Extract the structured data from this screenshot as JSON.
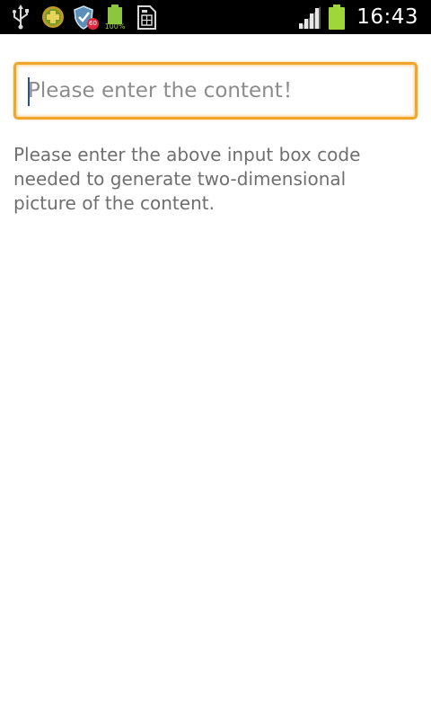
{
  "status_bar": {
    "notification_icons": [
      "usb-icon",
      "game-controller-icon",
      "shield-icon",
      "battery-full-icon",
      "sim-card-icon"
    ],
    "shield_badge": "60",
    "battery_notification_label": "100%",
    "signal_icon": "signal-bars-icon",
    "battery_icon": "battery-icon",
    "time": "16:43"
  },
  "form": {
    "content_input": {
      "value": "",
      "placeholder": "Please enter the content！"
    },
    "hint_text": "Please enter the above input box code needed to generate two-dimensional picture of the content."
  },
  "colors": {
    "status_bar_bg": "#000000",
    "input_focus_border": "#f0a52d",
    "battery_green": "#8cc63f",
    "hint_text": "#6f6f6f"
  }
}
